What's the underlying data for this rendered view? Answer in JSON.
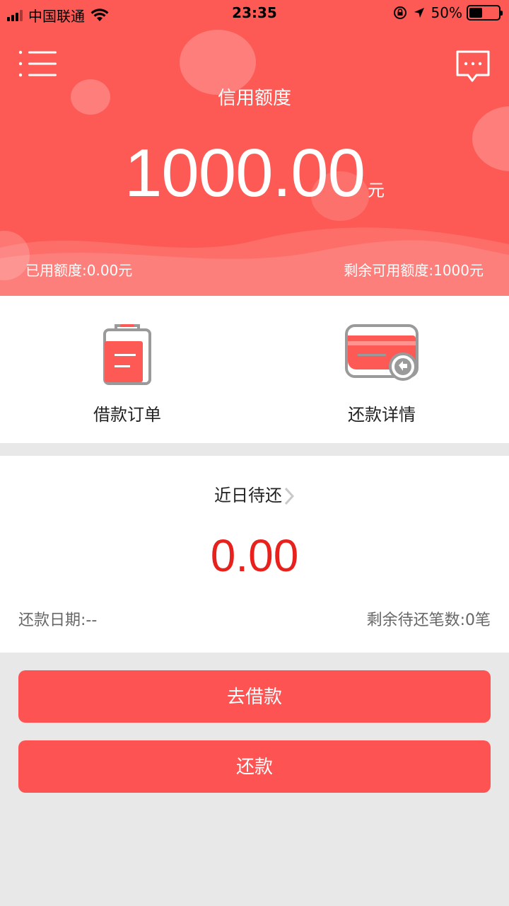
{
  "status_bar": {
    "carrier": "中国联通",
    "time": "23:35",
    "battery_percent": "50%",
    "battery_level": 0.5
  },
  "header": {
    "menu_icon": "menu-icon",
    "message_icon": "message-icon",
    "title": "信用额度",
    "amount": "1000.00",
    "unit": "元",
    "used": "已用额度:0.00元",
    "remaining": "剩余可用额度:1000元"
  },
  "quick_actions": [
    {
      "label": "借款订单",
      "icon": "clipboard-icon"
    },
    {
      "label": "还款详情",
      "icon": "card-repay-icon"
    }
  ],
  "repayment": {
    "title": "近日待还",
    "amount": "0.00",
    "date": "还款日期:--",
    "remaining_count": "剩余待还笔数:0笔"
  },
  "buttons": {
    "borrow": "去借款",
    "repay": "还款"
  },
  "colors": {
    "primary": "#fd5a55",
    "button": "#fd5352",
    "amount_red": "#e8211d",
    "background": "#e8e8e8"
  }
}
